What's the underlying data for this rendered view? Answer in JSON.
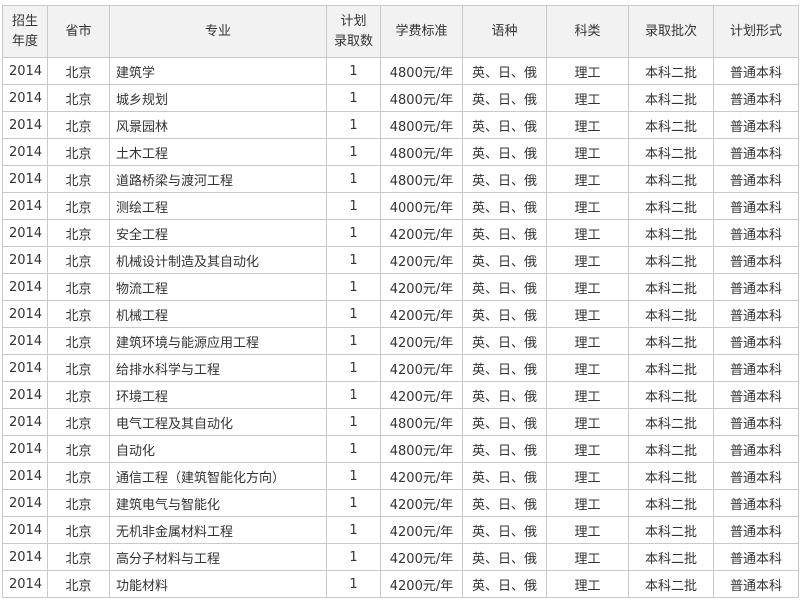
{
  "headers": {
    "year_line1": "招生",
    "year_line2": "年度",
    "province": "省市",
    "major": "专业",
    "quota_line1": "计划",
    "quota_line2": "录取数",
    "tuition": "学费标准",
    "language": "语种",
    "category": "科类",
    "batch": "录取批次",
    "form": "计划形式"
  },
  "rows": [
    {
      "year": "2014",
      "province": "北京",
      "major": "建筑学",
      "quota": "1",
      "tuition": "4800元/年",
      "language": "英、日、俄",
      "category": "理工",
      "batch": "本科二批",
      "form": "普通本科"
    },
    {
      "year": "2014",
      "province": "北京",
      "major": "城乡规划",
      "quota": "1",
      "tuition": "4800元/年",
      "language": "英、日、俄",
      "category": "理工",
      "batch": "本科二批",
      "form": "普通本科"
    },
    {
      "year": "2014",
      "province": "北京",
      "major": "风景园林",
      "quota": "1",
      "tuition": "4800元/年",
      "language": "英、日、俄",
      "category": "理工",
      "batch": "本科二批",
      "form": "普通本科"
    },
    {
      "year": "2014",
      "province": "北京",
      "major": "土木工程",
      "quota": "1",
      "tuition": "4800元/年",
      "language": "英、日、俄",
      "category": "理工",
      "batch": "本科二批",
      "form": "普通本科"
    },
    {
      "year": "2014",
      "province": "北京",
      "major": "道路桥梁与渡河工程",
      "quota": "1",
      "tuition": "4800元/年",
      "language": "英、日、俄",
      "category": "理工",
      "batch": "本科二批",
      "form": "普通本科"
    },
    {
      "year": "2014",
      "province": "北京",
      "major": "测绘工程",
      "quota": "1",
      "tuition": "4000元/年",
      "language": "英、日、俄",
      "category": "理工",
      "batch": "本科二批",
      "form": "普通本科"
    },
    {
      "year": "2014",
      "province": "北京",
      "major": "安全工程",
      "quota": "1",
      "tuition": "4200元/年",
      "language": "英、日、俄",
      "category": "理工",
      "batch": "本科二批",
      "form": "普通本科"
    },
    {
      "year": "2014",
      "province": "北京",
      "major": "机械设计制造及其自动化",
      "quota": "1",
      "tuition": "4200元/年",
      "language": "英、日、俄",
      "category": "理工",
      "batch": "本科二批",
      "form": "普通本科"
    },
    {
      "year": "2014",
      "province": "北京",
      "major": "物流工程",
      "quota": "1",
      "tuition": "4200元/年",
      "language": "英、日、俄",
      "category": "理工",
      "batch": "本科二批",
      "form": "普通本科"
    },
    {
      "year": "2014",
      "province": "北京",
      "major": "机械工程",
      "quota": "1",
      "tuition": "4200元/年",
      "language": "英、日、俄",
      "category": "理工",
      "batch": "本科二批",
      "form": "普通本科"
    },
    {
      "year": "2014",
      "province": "北京",
      "major": "建筑环境与能源应用工程",
      "quota": "1",
      "tuition": "4200元/年",
      "language": "英、日、俄",
      "category": "理工",
      "batch": "本科二批",
      "form": "普通本科"
    },
    {
      "year": "2014",
      "province": "北京",
      "major": "给排水科学与工程",
      "quota": "1",
      "tuition": "4200元/年",
      "language": "英、日、俄",
      "category": "理工",
      "batch": "本科二批",
      "form": "普通本科"
    },
    {
      "year": "2014",
      "province": "北京",
      "major": "环境工程",
      "quota": "1",
      "tuition": "4200元/年",
      "language": "英、日、俄",
      "category": "理工",
      "batch": "本科二批",
      "form": "普通本科"
    },
    {
      "year": "2014",
      "province": "北京",
      "major": "电气工程及其自动化",
      "quota": "1",
      "tuition": "4800元/年",
      "language": "英、日、俄",
      "category": "理工",
      "batch": "本科二批",
      "form": "普通本科"
    },
    {
      "year": "2014",
      "province": "北京",
      "major": "自动化",
      "quota": "1",
      "tuition": "4800元/年",
      "language": "英、日、俄",
      "category": "理工",
      "batch": "本科二批",
      "form": "普通本科"
    },
    {
      "year": "2014",
      "province": "北京",
      "major": "通信工程（建筑智能化方向）",
      "quota": "1",
      "tuition": "4200元/年",
      "language": "英、日、俄",
      "category": "理工",
      "batch": "本科二批",
      "form": "普通本科"
    },
    {
      "year": "2014",
      "province": "北京",
      "major": "建筑电气与智能化",
      "quota": "1",
      "tuition": "4200元/年",
      "language": "英、日、俄",
      "category": "理工",
      "batch": "本科二批",
      "form": "普通本科"
    },
    {
      "year": "2014",
      "province": "北京",
      "major": "无机非金属材料工程",
      "quota": "1",
      "tuition": "4200元/年",
      "language": "英、日、俄",
      "category": "理工",
      "batch": "本科二批",
      "form": "普通本科"
    },
    {
      "year": "2014",
      "province": "北京",
      "major": "高分子材料与工程",
      "quota": "1",
      "tuition": "4200元/年",
      "language": "英、日、俄",
      "category": "理工",
      "batch": "本科二批",
      "form": "普通本科"
    },
    {
      "year": "2014",
      "province": "北京",
      "major": "功能材料",
      "quota": "1",
      "tuition": "4200元/年",
      "language": "英、日、俄",
      "category": "理工",
      "batch": "本科二批",
      "form": "普通本科"
    }
  ]
}
